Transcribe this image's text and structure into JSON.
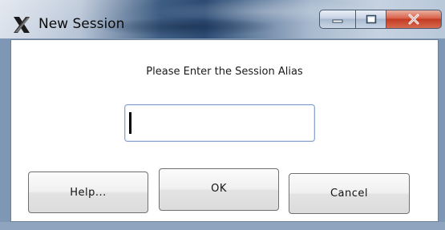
{
  "window": {
    "title": "New Session",
    "icon": "x-app-icon"
  },
  "caption_buttons": {
    "minimize_icon": "minimize-icon",
    "maximize_icon": "maximize-icon",
    "close_icon": "close-icon"
  },
  "dialog": {
    "prompt": "Please Enter the Session Alias",
    "alias_value": "",
    "alias_placeholder": ""
  },
  "buttons": {
    "help": "Help...",
    "ok": "OK",
    "cancel": "Cancel"
  },
  "colors": {
    "close_red": "#c23a22",
    "input_border": "#8aa6cf"
  }
}
